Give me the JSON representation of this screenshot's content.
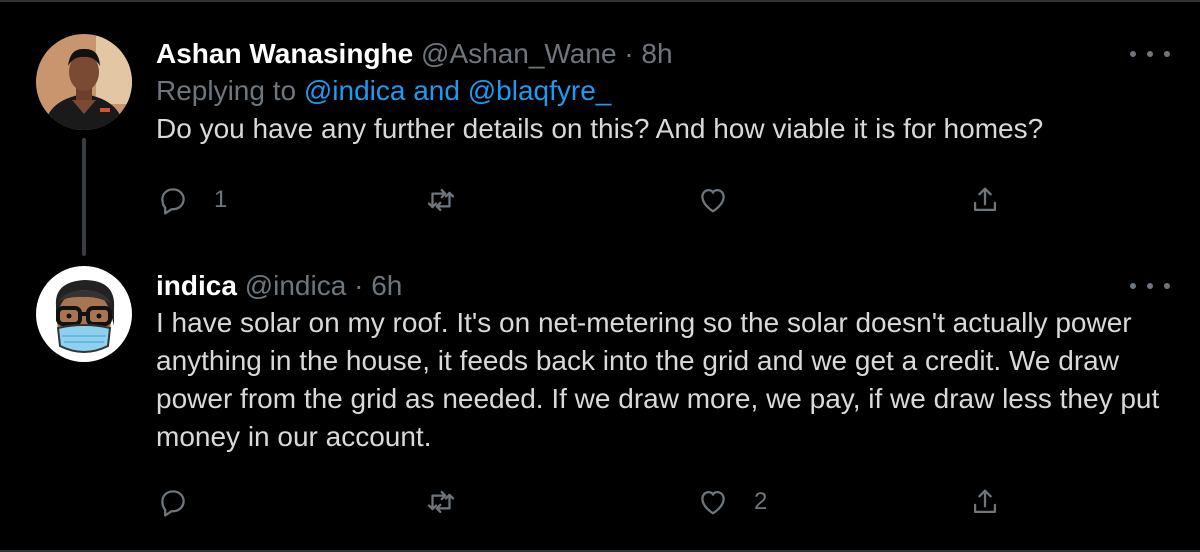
{
  "tweets": [
    {
      "name": "Ashan Wanasinghe",
      "handle": "@Ashan_Wane",
      "separator": "·",
      "time": "8h",
      "replying_prefix": "Replying to ",
      "replying_mentions": "@indica and @blaqfyre_",
      "text": "Do you have any further details on this? And how viable it is for homes?",
      "reply_count": "1",
      "retweet_count": "",
      "like_count": "",
      "avatar_icon": "user-photo-avatar"
    },
    {
      "name": "indica",
      "handle": "@indica",
      "separator": "·",
      "time": "6h",
      "text": "I have solar on my roof. It's on net-metering so the solar doesn't actually power anything in the house, it feeds back into the grid and we get a credit. We draw power from the grid as needed. If we draw more, we pay, if we draw less they put money in our account.",
      "reply_count": "",
      "retweet_count": "",
      "like_count": "2",
      "avatar_icon": "cartoon-mask-avatar"
    }
  ],
  "icons": {
    "reply": "reply-icon",
    "retweet": "retweet-icon",
    "like": "heart-icon",
    "share": "share-icon",
    "more": "more-icon"
  },
  "colors": {
    "background": "#000000",
    "text": "#d9d9d9",
    "name": "#ffffff",
    "muted": "#6e767d",
    "mention": "#1d9bf0",
    "divider": "#2f3336"
  }
}
